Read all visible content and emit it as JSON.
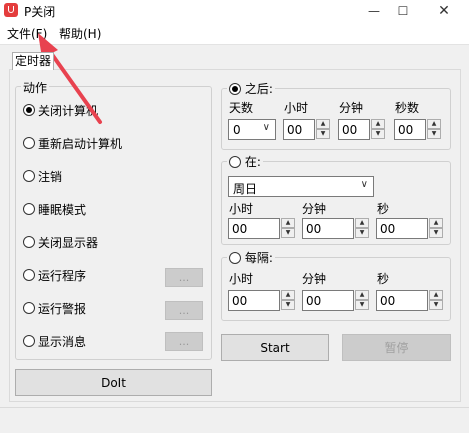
{
  "window": {
    "title": "P关闭"
  },
  "menu": {
    "file": "文件(F)",
    "help": "帮助(H)"
  },
  "tab": {
    "label": "定时器"
  },
  "actions": {
    "legend": "动作",
    "items": [
      {
        "label": "关闭计算机",
        "checked": true
      },
      {
        "label": "重新启动计算机",
        "checked": false
      },
      {
        "label": "注销",
        "checked": false
      },
      {
        "label": "睡眠模式",
        "checked": false
      },
      {
        "label": "关闭显示器",
        "checked": false
      },
      {
        "label": "运行程序",
        "checked": false,
        "button": "..."
      },
      {
        "label": "运行警报",
        "checked": false,
        "button": "..."
      },
      {
        "label": "显示消息",
        "checked": false,
        "button": "..."
      }
    ],
    "doit": "DoIt"
  },
  "after": {
    "label": "之后:",
    "checked": true,
    "cols": [
      "天数",
      "小时",
      "分钟",
      "秒数"
    ],
    "days": "0",
    "hours": "00",
    "minutes": "00",
    "seconds": "00"
  },
  "at": {
    "label": "在:",
    "checked": false,
    "weekday": "周日",
    "cols": [
      "小时",
      "分钟",
      "秒"
    ],
    "hours": "00",
    "minutes": "00",
    "seconds": "00"
  },
  "every": {
    "label": "每隔:",
    "checked": false,
    "cols": [
      "小时",
      "分钟",
      "秒"
    ],
    "hours": "00",
    "minutes": "00",
    "seconds": "00"
  },
  "controls": {
    "start": "Start",
    "pause": "暂停"
  },
  "colors": {
    "annotation_arrow": "#e8424f",
    "accent": "#e43d3d"
  },
  "icons": {
    "app": "power-app-icon",
    "minimize": "minimize-icon",
    "maximize": "maximize-icon",
    "close": "close-icon"
  }
}
